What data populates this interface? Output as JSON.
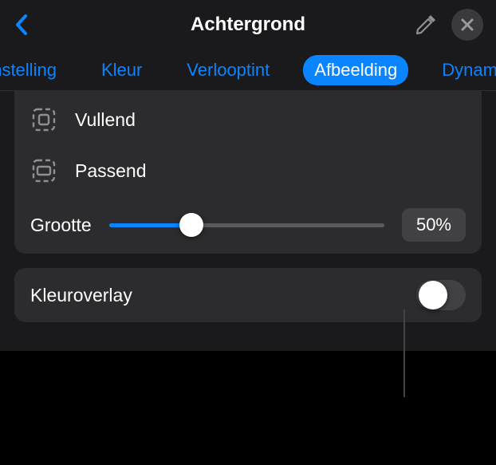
{
  "header": {
    "title": "Achtergrond"
  },
  "tabs": {
    "t0": "rinstelling",
    "t1": "Kleur",
    "t2": "Verlooptint",
    "t3": "Afbeelding",
    "t4": "Dynamis"
  },
  "scale": {
    "fill": "Vullend",
    "fit": "Passend"
  },
  "size": {
    "label": "Grootte",
    "value": "50%",
    "percent": 50
  },
  "overlay": {
    "label": "Kleuroverlay",
    "on": false
  }
}
